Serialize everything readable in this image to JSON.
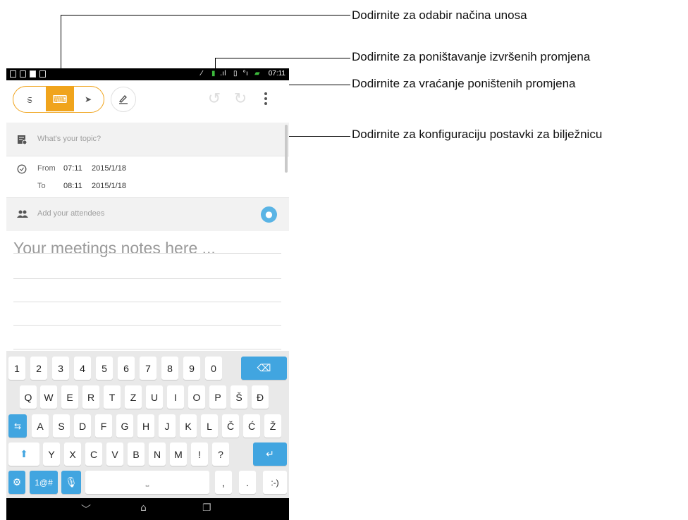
{
  "annotations": {
    "input_mode": "Dodirnite za odabir načina unosa",
    "undo": "Dodirnite za poništavanje izvršenih promjena",
    "redo": "Dodirnite za vraćanje poništenih promjena",
    "settings": "Dodirnite za konfiguraciju postavki za bilježnicu"
  },
  "status_bar": {
    "time": "07:11"
  },
  "toolbar": {
    "modes": [
      {
        "name": "handwriting",
        "icon": "squiggle-icon",
        "glyph": "ಽ"
      },
      {
        "name": "keyboard",
        "icon": "keyboard-icon",
        "glyph": "⌨",
        "active": true
      },
      {
        "name": "draw",
        "icon": "pen-icon",
        "glyph": "➤"
      }
    ],
    "pen_style_icon": "pen-style-icon",
    "undo_icon": "undo-icon",
    "redo_icon": "redo-icon",
    "menu_icon": "more-vertical-icon"
  },
  "meeting": {
    "topic_placeholder": "What's your topic?",
    "from_label": "From",
    "from_time": "07:11",
    "from_date": "2015/1/18",
    "to_label": "To",
    "to_time": "08:11",
    "to_date": "2015/1/18",
    "attendees_placeholder": "Add your attendees",
    "notes_placeholder": "Your meetings notes here ..."
  },
  "keyboard": {
    "row1": [
      "1",
      "2",
      "3",
      "4",
      "5",
      "6",
      "7",
      "8",
      "9",
      "0"
    ],
    "row2": [
      "Q",
      "W",
      "E",
      "R",
      "T",
      "Z",
      "U",
      "I",
      "O",
      "P",
      "Š",
      "Đ"
    ],
    "row3": [
      "A",
      "S",
      "D",
      "F",
      "G",
      "H",
      "J",
      "K",
      "L",
      "Č",
      "Ć",
      "Ž"
    ],
    "row4": [
      "Y",
      "X",
      "C",
      "V",
      "B",
      "N",
      "M",
      "!",
      "?"
    ],
    "symbols_key": "1@#",
    "comma_key": ",",
    "period_key": ".",
    "emoticon_key": ":-)",
    "backspace_icon": "backspace-icon",
    "tab_icon": "tab-icon",
    "shift_icon": "shift-icon",
    "enter_icon": "enter-icon",
    "settings_icon": "gear-icon",
    "mic_icon": "microphone-icon",
    "space_icon": "space-icon"
  },
  "colors": {
    "accent": "#f0a41c",
    "key_blue": "#41a5e0",
    "avatar": "#5ab4e5"
  }
}
